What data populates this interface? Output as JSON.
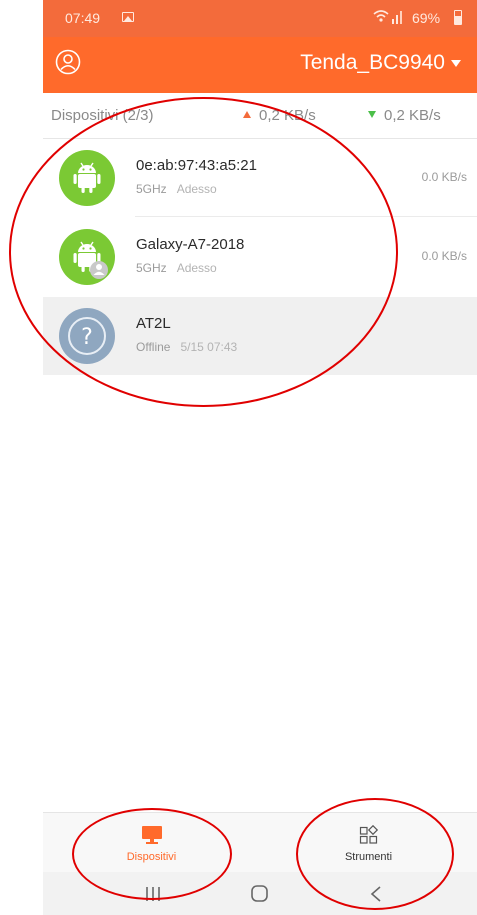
{
  "status_bar": {
    "time": "07:49",
    "battery": "69%"
  },
  "header": {
    "network_name": "Tenda_BC9940"
  },
  "stats": {
    "devices_count": "Dispositivi (2/3)",
    "upload": "0,2 KB/s",
    "download": "0,2 KB/s"
  },
  "devices": [
    {
      "name": "0e:ab:97:43:a5:21",
      "band": "5GHz",
      "status": "Adesso",
      "speed": "0.0 KB/s",
      "icon": "android-icon"
    },
    {
      "name": "Galaxy-A7-2018",
      "band": "5GHz",
      "status": "Adesso",
      "speed": "0.0 KB/s",
      "icon": "android-user-icon"
    },
    {
      "name": "AT2L",
      "band": "Offline",
      "status": "5/15 07:43",
      "speed": "",
      "icon": "unknown-device-icon"
    }
  ],
  "tabs": [
    {
      "label": "Dispositivi",
      "icon": "monitor-icon",
      "active": true
    },
    {
      "label": "Strumenti",
      "icon": "tools-grid-icon",
      "active": false
    }
  ],
  "colors": {
    "brand": "#ff6a2b",
    "android": "#7bc934",
    "unknown": "#8fa7c0",
    "annotation": "#e00000"
  }
}
